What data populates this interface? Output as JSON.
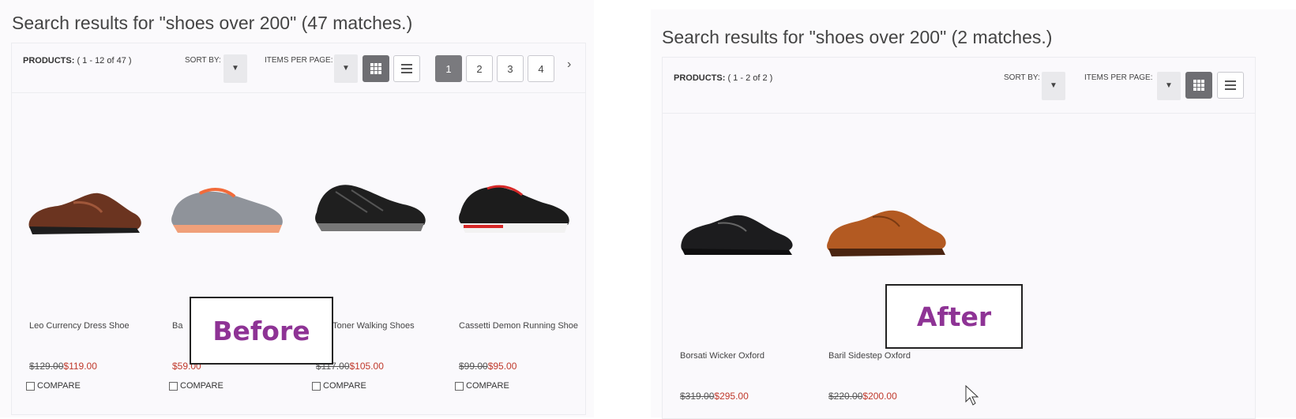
{
  "colors": {
    "accent_label": "#8e3395",
    "sale_price": "#c0392b"
  },
  "before": {
    "title": "Search results for \"shoes over 200\" (47 matches.)",
    "toolbar": {
      "products_prefix": "PRODUCTS:",
      "products_range": "( 1 - 12 of 47 )",
      "sort_by": "SORT BY:",
      "items_per_page": "ITEMS PER PAGE:",
      "pages": [
        "1",
        "2",
        "3",
        "4"
      ],
      "current_page": "1",
      "next": "›"
    },
    "products": [
      {
        "name": "Leo Currency Dress Shoe",
        "old_price": "$129.00",
        "price": "$119.00",
        "compare": "COMPARE"
      },
      {
        "name": "Ba",
        "old_price": "",
        "price": "$59.00",
        "compare": "COMPARE"
      },
      {
        "name": "eo Toner Walking Shoes",
        "old_price": "$117.00",
        "price": "$105.00",
        "compare": "COMPARE"
      },
      {
        "name": "Cassetti Demon Running Shoe",
        "old_price": "$99.00",
        "price": "$95.00",
        "compare": "COMPARE"
      }
    ],
    "label": "Before"
  },
  "after": {
    "title": "Search results for \"shoes over 200\" (2 matches.)",
    "toolbar": {
      "products_prefix": "PRODUCTS:",
      "products_range": "( 1 - 2 of 2 )",
      "sort_by": "SORT BY:",
      "items_per_page": "ITEMS PER PAGE:"
    },
    "products": [
      {
        "name": "Borsati Wicker Oxford",
        "old_price": "$319.00",
        "price": "$295.00"
      },
      {
        "name": "Baril Sidestep Oxford",
        "old_price": "$220.00",
        "price": "$200.00"
      }
    ],
    "label": "After"
  },
  "icons": [
    "chevron-down-icon",
    "grid-view-icon",
    "list-view-icon",
    "mouse-cursor-icon"
  ]
}
